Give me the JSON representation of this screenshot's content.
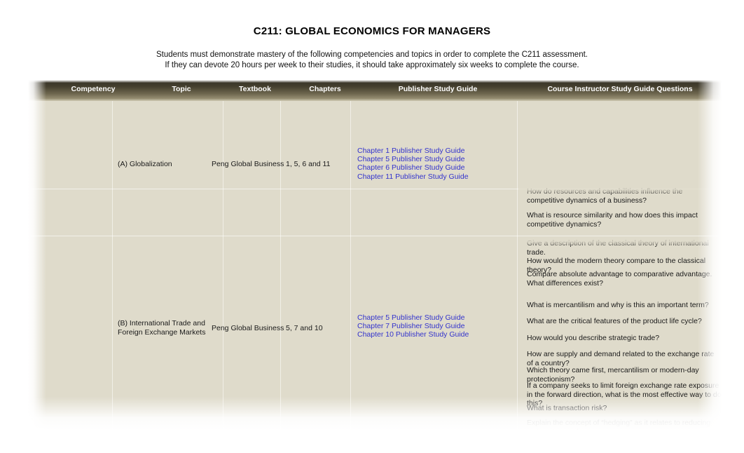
{
  "document": {
    "title": "C211: GLOBAL ECONOMICS FOR MANAGERS",
    "intro_line1": "Students must demonstrate mastery of the following competencies and topics in order to complete the C211 assessment.",
    "intro_line2": "If they can devote 20 hours per week to their studies, it should take approximately six weeks to complete the course."
  },
  "colors": {
    "sheet_background": "#dfdbcb",
    "header_dark": "#3b3729",
    "header_light": "#948c70",
    "link": "#3333cc",
    "text": "#1a1a1a",
    "page": "#ffffff"
  },
  "table": {
    "headers": [
      "Competency",
      "Topic",
      "Textbook",
      "Chapters",
      "Publisher Study Guide",
      "Course Instructor Study Guide Questions"
    ],
    "rows": [
      {
        "competency": "",
        "topic": "(A) Globalization",
        "textbook": "Peng Global Business",
        "chapters": "1, 5, 6 and 11",
        "publisher_study_guide": [
          "Chapter 1 Publisher Study Guide",
          "Chapter 5 Publisher Study Guide",
          "Chapter 6 Publisher Study Guide",
          "Chapter 11 Publisher Study Guide"
        ]
      },
      {
        "competency": "",
        "topic": "(B) International Trade and Foreign Exchange Markets",
        "topic_line1": "(B) International Trade and",
        "topic_line2": "Foreign Exchange Markets",
        "textbook": "Peng Global Business",
        "chapters": "5, 7 and 10",
        "publisher_study_guide": [
          "Chapter 5 Publisher Study Guide",
          "Chapter 7 Publisher Study Guide",
          "Chapter 10 Publisher Study Guide"
        ]
      }
    ],
    "instructor_questions": [
      "How do resources and capabilities influence the competitive dynamics of a business?",
      "What is resource similarity and how does this impact competitive dynamics?",
      "Give a description of the classical theory of international trade.",
      "How would the modern theory compare to the classical theory?",
      "Compare absolute advantage to comparative advantage. What differences exist?",
      "What is mercantilism and why is this an important term?",
      "What are the critical features of the product life cycle?",
      "How would you describe strategic trade?",
      "How are supply and demand related to the exchange rate of a country?",
      "Which theory came first, mercantilism or modern-day protectionism?",
      "If a company seeks to limit foreign exchange rate exposure in the forward direction, what is the most effective way to do this?",
      "What is transaction risk?",
      "Explain the concept of “hedging” as it relates to reducing various types of"
    ]
  }
}
